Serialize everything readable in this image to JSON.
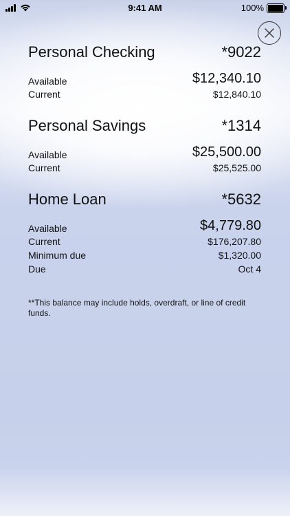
{
  "status_bar": {
    "time": "9:41 AM",
    "battery": "100%"
  },
  "accounts": [
    {
      "name": "Personal Checking",
      "number": "*9022",
      "rows": [
        {
          "label": "Available",
          "value": "$12,340.10"
        },
        {
          "label": "Current",
          "value": "$12,840.10"
        }
      ]
    },
    {
      "name": "Personal Savings",
      "number": "*1314",
      "rows": [
        {
          "label": "Available",
          "value": "$25,500.00"
        },
        {
          "label": "Current",
          "value": "$25,525.00"
        }
      ]
    },
    {
      "name": "Home Loan",
      "number": "*5632",
      "rows": [
        {
          "label": "Available",
          "value": "$4,779.80"
        },
        {
          "label": "Current",
          "value": "$176,207.80"
        },
        {
          "label": "Minimum due",
          "value": "$1,320.00"
        },
        {
          "label": "Due",
          "value": "Oct 4"
        }
      ]
    }
  ],
  "footnote": "**This balance may include holds, overdraft, or line of credit funds."
}
